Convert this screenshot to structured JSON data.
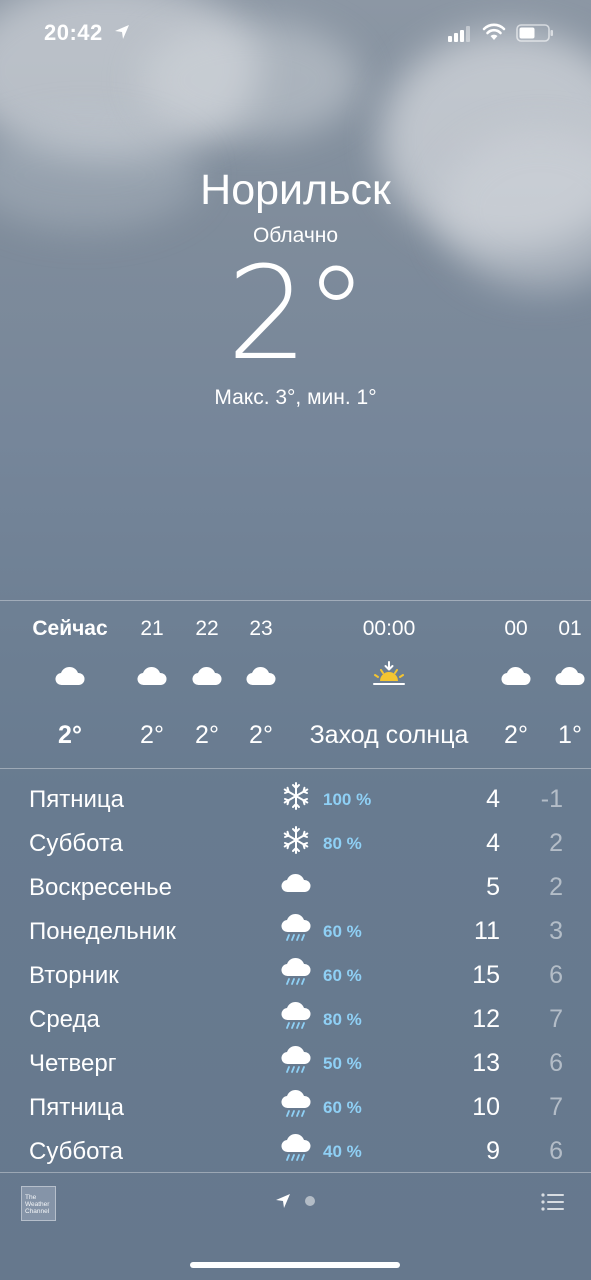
{
  "status_bar": {
    "time": "20:42",
    "icons": [
      "location-arrow-icon",
      "cellular-signal-icon",
      "wifi-icon",
      "battery-icon"
    ]
  },
  "current": {
    "city": "Норильск",
    "condition": "Облачно",
    "temperature": "2°",
    "high_low": "Макс. 3°, мин. 1°"
  },
  "hourly": [
    {
      "label": "Сейчас",
      "icon": "cloud-icon",
      "temp": "2°"
    },
    {
      "label": "21",
      "icon": "cloud-icon",
      "temp": "2°"
    },
    {
      "label": "22",
      "icon": "cloud-icon",
      "temp": "2°"
    },
    {
      "label": "23",
      "icon": "cloud-icon",
      "temp": "2°"
    },
    {
      "label": "00:00",
      "icon": "sunset-icon",
      "temp": "Заход солнца"
    },
    {
      "label": "00",
      "icon": "cloud-icon",
      "temp": "2°"
    },
    {
      "label": "01",
      "icon": "cloud-icon",
      "temp": "1°"
    }
  ],
  "daily": [
    {
      "day": "Пятница",
      "icon": "snowflake-icon",
      "precip": "100 %",
      "high": "4",
      "low": "-1"
    },
    {
      "day": "Суббота",
      "icon": "snowflake-icon",
      "precip": "80 %",
      "high": "4",
      "low": "2"
    },
    {
      "day": "Воскресенье",
      "icon": "cloud-icon",
      "precip": "",
      "high": "5",
      "low": "2"
    },
    {
      "day": "Понедельник",
      "icon": "cloud-rain-icon",
      "precip": "60 %",
      "high": "11",
      "low": "3"
    },
    {
      "day": "Вторник",
      "icon": "cloud-rain-icon",
      "precip": "60 %",
      "high": "15",
      "low": "6"
    },
    {
      "day": "Среда",
      "icon": "cloud-rain-icon",
      "precip": "80 %",
      "high": "12",
      "low": "7"
    },
    {
      "day": "Четверг",
      "icon": "cloud-rain-icon",
      "precip": "50 %",
      "high": "13",
      "low": "6"
    },
    {
      "day": "Пятница",
      "icon": "cloud-rain-icon",
      "precip": "60 %",
      "high": "10",
      "low": "7"
    },
    {
      "day": "Суббота",
      "icon": "cloud-rain-icon",
      "precip": "40 %",
      "high": "9",
      "low": "6"
    }
  ],
  "bottom_bar": {
    "provider_logo_text": "The\nWeather\nChannel",
    "icons": [
      "location-arrow-icon",
      "page-dot-icon",
      "list-icon"
    ]
  },
  "colors": {
    "precip_text": "#8fd0f5",
    "sun": "#f4c531"
  }
}
